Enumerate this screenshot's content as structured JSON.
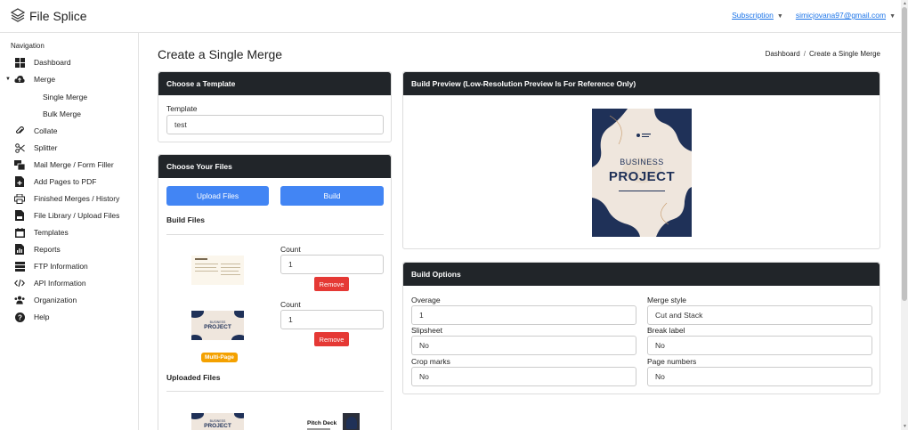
{
  "app": {
    "name": "File Splice"
  },
  "header": {
    "subscription_label": "Subscription",
    "email": "simicjovana97@gmail.com"
  },
  "sidebar": {
    "heading": "Navigation",
    "items": [
      {
        "label": "Dashboard",
        "icon": "grid-icon"
      },
      {
        "label": "Merge",
        "icon": "cloud-upload-icon"
      },
      {
        "label": "Collate",
        "icon": "paperclip-icon"
      },
      {
        "label": "Splitter",
        "icon": "scissors-icon"
      },
      {
        "label": "Mail Merge / Form Filler",
        "icon": "mail-merge-icon"
      },
      {
        "label": "Add Pages to PDF",
        "icon": "file-add-icon"
      },
      {
        "label": "Finished Merges / History",
        "icon": "printer-icon"
      },
      {
        "label": "File Library / Upload Files",
        "icon": "pdf-file-icon"
      },
      {
        "label": "Templates",
        "icon": "calendar-icon"
      },
      {
        "label": "Reports",
        "icon": "chart-icon"
      },
      {
        "label": "FTP Information",
        "icon": "server-icon"
      },
      {
        "label": "API Information",
        "icon": "code-icon"
      },
      {
        "label": "Organization",
        "icon": "users-icon"
      },
      {
        "label": "Help",
        "icon": "question-icon"
      }
    ],
    "merge_sub": [
      "Single Merge",
      "Bulk Merge"
    ]
  },
  "page": {
    "title": "Create a Single Merge",
    "breadcrumb": [
      "Dashboard",
      "/",
      "Create a Single Merge"
    ]
  },
  "template_card": {
    "title": "Choose a Template",
    "field_label": "Template",
    "value": "test"
  },
  "files_card": {
    "title": "Choose Your Files",
    "upload_label": "Upload Files",
    "build_label": "Build",
    "build_files_label": "Build Files",
    "uploaded_files_label": "Uploaded Files",
    "build_items": [
      {
        "count_label": "Count",
        "count": "1",
        "remove_label": "Remove",
        "badge": ""
      },
      {
        "count_label": "Count",
        "count": "1",
        "remove_label": "Remove",
        "badge": "Multi-Page"
      }
    ],
    "uploaded_thumb_text": "Pitch Deck"
  },
  "preview_card": {
    "title": "Build Preview (Low-Resolution Preview Is For Reference Only)",
    "cover_line1": "BUSINESS",
    "cover_line2": "PROJECT"
  },
  "options_card": {
    "title": "Build Options",
    "fields": {
      "overage": {
        "label": "Overage",
        "value": "1"
      },
      "merge_style": {
        "label": "Merge style",
        "value": "Cut and Stack"
      },
      "slipsheet": {
        "label": "Slipsheet",
        "value": "No"
      },
      "break_label": {
        "label": "Break label",
        "value": "No"
      },
      "crop_marks": {
        "label": "Crop marks",
        "value": "No"
      },
      "page_numbers": {
        "label": "Page numbers",
        "value": "No"
      }
    }
  },
  "colors": {
    "card_header": "#212529",
    "primary": "#4285f4",
    "danger": "#e53935",
    "badge": "#f4a100",
    "navy": "#1f3158",
    "cream": "#efe6dd"
  }
}
